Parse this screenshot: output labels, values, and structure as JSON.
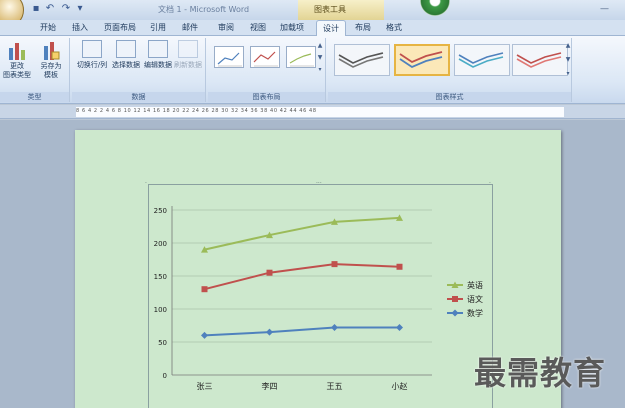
{
  "window": {
    "title": "文档 1 - Microsoft Word",
    "context_tab_label": "图表工具"
  },
  "tabs": [
    {
      "label": "开始",
      "active": false
    },
    {
      "label": "插入",
      "active": false
    },
    {
      "label": "页面布局",
      "active": false
    },
    {
      "label": "引用",
      "active": false
    },
    {
      "label": "邮件",
      "active": false
    },
    {
      "label": "审阅",
      "active": false
    },
    {
      "label": "视图",
      "active": false
    },
    {
      "label": "加载项",
      "active": false
    },
    {
      "label": "设计",
      "active": true
    },
    {
      "label": "布局",
      "active": false
    },
    {
      "label": "格式",
      "active": false
    }
  ],
  "ribbon": {
    "type_group": {
      "label": "类型",
      "change_chart_type": "更改\n图表类型",
      "save_as_template": "另存为\n模板"
    },
    "data_group": {
      "label": "数据",
      "switch_row_col": "切换行/列",
      "select_data": "选择数据",
      "edit_data": "编辑数据",
      "refresh_data": "刷新数据"
    },
    "layout_group": {
      "label": "图表布局"
    },
    "styles_group": {
      "label": "图表样式"
    }
  },
  "ruler_text": "8  6  4  2     2  4  6  8  10  12  14  16  18  20  22  24  26  28  30  32  34  36  38  40  42  44  46  48",
  "colors": {
    "english": "#9bbb59",
    "chinese": "#c0504d",
    "math": "#4f81bd",
    "page": "#cde8cd"
  },
  "chart_data": {
    "type": "line",
    "categories": [
      "张三",
      "李四",
      "王五",
      "小赵"
    ],
    "series": [
      {
        "name": "英语",
        "values": [
          190,
          212,
          232,
          238
        ]
      },
      {
        "name": "语文",
        "values": [
          130,
          155,
          168,
          164
        ]
      },
      {
        "name": "数学",
        "values": [
          60,
          65,
          72,
          72
        ]
      }
    ],
    "yticks": [
      "0",
      "50",
      "100",
      "150",
      "200",
      "250"
    ],
    "ylim": [
      0,
      250
    ],
    "grid": true,
    "legend": "right"
  },
  "watermark": "最需教育"
}
